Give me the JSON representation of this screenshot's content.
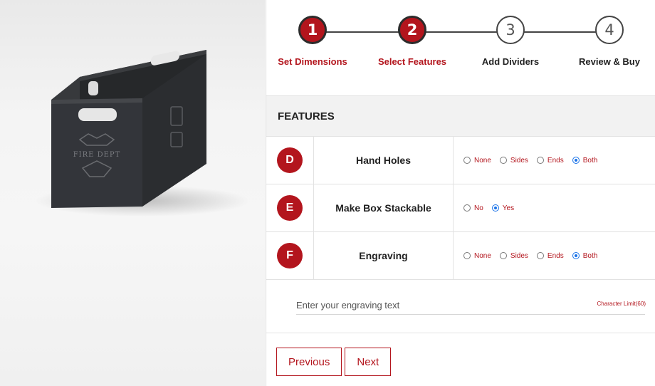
{
  "preview": {
    "engraving_label": "FIRE DEPT"
  },
  "stepper": {
    "steps": [
      {
        "number": "1",
        "label": "Set Dimensions",
        "state": "completed"
      },
      {
        "number": "2",
        "label": "Select Features",
        "state": "current"
      },
      {
        "number": "3",
        "label": "Add Dividers",
        "state": "upcoming"
      },
      {
        "number": "4",
        "label": "Review & Buy",
        "state": "upcoming"
      }
    ]
  },
  "features": {
    "title": "FEATURES",
    "rows": [
      {
        "badge": "D",
        "name": "Hand Holes",
        "options": [
          {
            "label": "None",
            "checked": false
          },
          {
            "label": "Sides",
            "checked": false
          },
          {
            "label": "Ends",
            "checked": false
          },
          {
            "label": "Both",
            "checked": true
          }
        ]
      },
      {
        "badge": "E",
        "name": "Make Box Stackable",
        "options": [
          {
            "label": "No",
            "checked": false
          },
          {
            "label": "Yes",
            "checked": true
          }
        ]
      },
      {
        "badge": "F",
        "name": "Engraving",
        "options": [
          {
            "label": "None",
            "checked": false
          },
          {
            "label": "Sides",
            "checked": false
          },
          {
            "label": "Ends",
            "checked": false
          },
          {
            "label": "Both",
            "checked": true
          }
        ]
      }
    ],
    "engraving_input": {
      "value": "",
      "placeholder": "Enter your engraving text",
      "char_limit_label": "Character Limit(60)"
    }
  },
  "nav": {
    "previous_label": "Previous",
    "next_label": "Next"
  },
  "colors": {
    "accent": "#b3151d",
    "radio_checked": "#1a73e8",
    "box": "#2f3134"
  }
}
